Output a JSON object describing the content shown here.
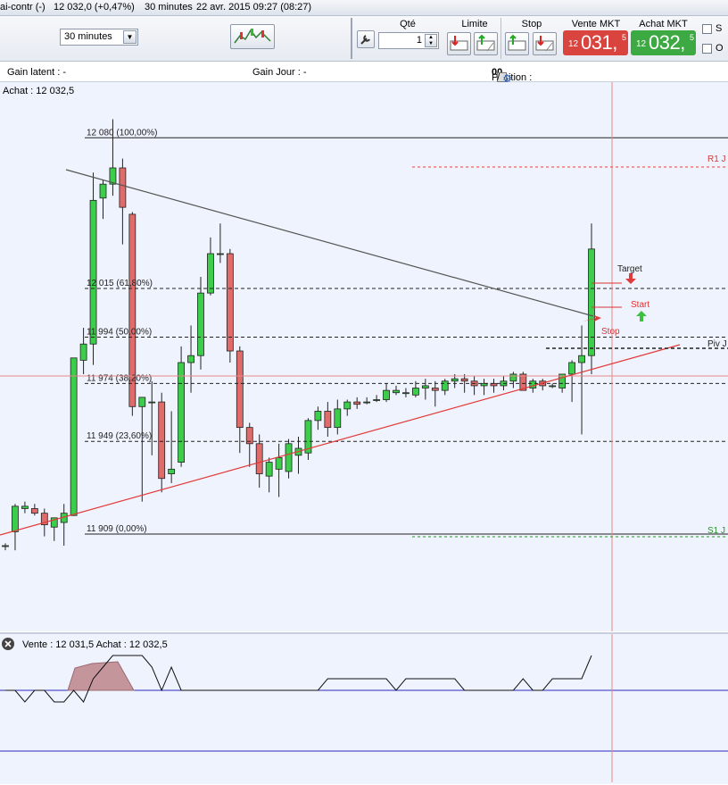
{
  "titlebar": {
    "instrument": "ai-contr (-)",
    "quote": "12 032,0 (+0,47%)",
    "interval": "30 minutes",
    "datetime": "22 avr. 2015 09:27 (08:27)"
  },
  "toolbar": {
    "timeframe": "30 minutes",
    "qty_label": "Qté",
    "qty_value": "1",
    "limit_label": "Limite",
    "stop_label": "Stop",
    "sell_label": "Vente MKT",
    "buy_label": "Achat MKT",
    "sell_price": {
      "prefix": "12",
      "main": "031,",
      "sup": "5"
    },
    "buy_price": {
      "prefix": "12",
      "main": "032,",
      "sup": "5"
    },
    "check_s": "S",
    "check_o": "O",
    "colors": {
      "sell": "#d9443f",
      "buy": "#3da943"
    }
  },
  "infobar": {
    "gain_latent": "Gain latent : -",
    "gain_jour": "Gain Jour : -",
    "position_label": "Position : ",
    "position_value": "0",
    "position_sep": " / ",
    "position_value2": "0"
  },
  "chart": {
    "achat_label": "Achat : 12 032,5",
    "fib_levels": [
      {
        "label": "12 080 (100,00%)",
        "price": 12080
      },
      {
        "label": "12 015 (61,80%)",
        "price": 12015
      },
      {
        "label": "11 994 (50,00%)",
        "price": 11994
      },
      {
        "label": "11 974 (38,20%)",
        "price": 11974
      },
      {
        "label": "11 949 (23,60%)",
        "price": 11949
      },
      {
        "label": "11 909 (0,00%)",
        "price": 11909
      }
    ],
    "pivots": {
      "r1": "R1 J",
      "piv": "Piv J",
      "s1": "S1 J"
    },
    "order_labels": {
      "target": "Target",
      "start": "Start",
      "stop": "Stop"
    },
    "colors": {
      "up": "#3ccd4a",
      "down": "#e06b6b",
      "support": "#e23a3a",
      "resistance": "#555555"
    }
  },
  "indicator": {
    "label": "Vente : 12 031,5 Achat : 12 032,5"
  },
  "chart_data": {
    "type": "candlestick",
    "y_unit": "price",
    "candles": [
      {
        "o": 11904,
        "h": 11905,
        "l": 11902,
        "c": 11904
      },
      {
        "o": 11910,
        "h": 11922,
        "l": 11902,
        "c": 11921
      },
      {
        "o": 11920,
        "h": 11923,
        "l": 11918,
        "c": 11921
      },
      {
        "o": 11920,
        "h": 11922,
        "l": 11917,
        "c": 11918
      },
      {
        "o": 11918,
        "h": 11920,
        "l": 11908,
        "c": 11913
      },
      {
        "o": 11912,
        "h": 11915,
        "l": 11906,
        "c": 11916
      },
      {
        "o": 11914,
        "h": 11922,
        "l": 11904,
        "c": 11918
      },
      {
        "o": 11917,
        "h": 11985,
        "l": 11917,
        "c": 11985
      },
      {
        "o": 11984,
        "h": 11998,
        "l": 11978,
        "c": 11991
      },
      {
        "o": 11991,
        "h": 12065,
        "l": 11982,
        "c": 12053
      },
      {
        "o": 12054,
        "h": 12062,
        "l": 12045,
        "c": 12060
      },
      {
        "o": 12060,
        "h": 12088,
        "l": 12055,
        "c": 12067
      },
      {
        "o": 12067,
        "h": 12071,
        "l": 12034,
        "c": 12050
      },
      {
        "o": 12047,
        "h": 12048,
        "l": 11960,
        "c": 11964
      },
      {
        "o": 11964,
        "h": 11968,
        "l": 11923,
        "c": 11968
      },
      {
        "o": 11966,
        "h": 11975,
        "l": 11943,
        "c": 11966
      },
      {
        "o": 11966,
        "h": 11970,
        "l": 11927,
        "c": 11933
      },
      {
        "o": 11935,
        "h": 11962,
        "l": 11931,
        "c": 11937
      },
      {
        "o": 11940,
        "h": 11990,
        "l": 11938,
        "c": 11983
      },
      {
        "o": 11983,
        "h": 11999,
        "l": 11970,
        "c": 11986
      },
      {
        "o": 11986,
        "h": 12020,
        "l": 11980,
        "c": 12013
      },
      {
        "o": 12013,
        "h": 12037,
        "l": 12012,
        "c": 12030
      },
      {
        "o": 12030,
        "h": 12043,
        "l": 12026,
        "c": 12030
      },
      {
        "o": 12030,
        "h": 12032,
        "l": 11983,
        "c": 11988
      },
      {
        "o": 11988,
        "h": 11990,
        "l": 11944,
        "c": 11955
      },
      {
        "o": 11955,
        "h": 11957,
        "l": 11938,
        "c": 11948
      },
      {
        "o": 11948,
        "h": 11952,
        "l": 11929,
        "c": 11935
      },
      {
        "o": 11934,
        "h": 11942,
        "l": 11927,
        "c": 11940
      },
      {
        "o": 11937,
        "h": 11948,
        "l": 11925,
        "c": 11942
      },
      {
        "o": 11936,
        "h": 11950,
        "l": 11933,
        "c": 11948
      },
      {
        "o": 11943,
        "h": 11951,
        "l": 11935,
        "c": 11946
      },
      {
        "o": 11944,
        "h": 11959,
        "l": 11941,
        "c": 11958
      },
      {
        "o": 11958,
        "h": 11964,
        "l": 11954,
        "c": 11962
      },
      {
        "o": 11962,
        "h": 11966,
        "l": 11951,
        "c": 11955
      },
      {
        "o": 11955,
        "h": 11967,
        "l": 11952,
        "c": 11963
      },
      {
        "o": 11963,
        "h": 11967,
        "l": 11960,
        "c": 11966
      },
      {
        "o": 11966,
        "h": 11968,
        "l": 11963,
        "c": 11965
      },
      {
        "o": 11966,
        "h": 11968,
        "l": 11965,
        "c": 11966
      },
      {
        "o": 11967,
        "h": 11969,
        "l": 11966,
        "c": 11967
      },
      {
        "o": 11967,
        "h": 11974,
        "l": 11966,
        "c": 11971
      },
      {
        "o": 11970,
        "h": 11973,
        "l": 11969,
        "c": 11971
      },
      {
        "o": 11970,
        "h": 11972,
        "l": 11968,
        "c": 11970
      },
      {
        "o": 11969,
        "h": 11975,
        "l": 11968,
        "c": 11972
      },
      {
        "o": 11972,
        "h": 11976,
        "l": 11967,
        "c": 11973
      },
      {
        "o": 11972,
        "h": 11975,
        "l": 11964,
        "c": 11971
      },
      {
        "o": 11971,
        "h": 11976,
        "l": 11969,
        "c": 11975
      },
      {
        "o": 11975,
        "h": 11978,
        "l": 11972,
        "c": 11976
      },
      {
        "o": 11976,
        "h": 11978,
        "l": 11970,
        "c": 11975
      },
      {
        "o": 11975,
        "h": 11977,
        "l": 11969,
        "c": 11973
      },
      {
        "o": 11973,
        "h": 11976,
        "l": 11969,
        "c": 11974
      },
      {
        "o": 11974,
        "h": 11976,
        "l": 11970,
        "c": 11973
      },
      {
        "o": 11973,
        "h": 11977,
        "l": 11971,
        "c": 11975
      },
      {
        "o": 11975,
        "h": 11979,
        "l": 11972,
        "c": 11978
      },
      {
        "o": 11978,
        "h": 11979,
        "l": 11971,
        "c": 11971
      },
      {
        "o": 11972,
        "h": 11976,
        "l": 11970,
        "c": 11975
      },
      {
        "o": 11975,
        "h": 11976,
        "l": 11971,
        "c": 11973
      },
      {
        "o": 11973,
        "h": 11974,
        "l": 11972,
        "c": 11973
      },
      {
        "o": 11972,
        "h": 11978,
        "l": 11970,
        "c": 11978
      },
      {
        "o": 11978,
        "h": 11984,
        "l": 11966,
        "c": 11983
      },
      {
        "o": 11983,
        "h": 11999,
        "l": 11952,
        "c": 11986
      },
      {
        "o": 11986,
        "h": 12043,
        "l": 11978,
        "c": 12032
      }
    ],
    "price_axis": {
      "min": 11867,
      "max": 12104
    },
    "indicator_series": [
      52,
      52,
      51,
      52,
      52,
      51,
      51,
      52,
      51,
      53,
      54,
      55,
      55,
      55,
      55,
      54,
      52,
      54,
      52,
      52,
      52,
      52,
      52,
      52,
      52,
      52,
      52,
      52,
      52,
      52,
      52,
      52,
      52,
      53,
      53,
      53,
      53,
      53,
      53,
      53,
      52,
      53,
      53,
      53,
      53,
      53,
      53,
      52,
      52,
      52,
      52,
      52,
      52,
      53,
      52,
      52,
      53,
      53,
      53,
      53,
      55
    ]
  }
}
